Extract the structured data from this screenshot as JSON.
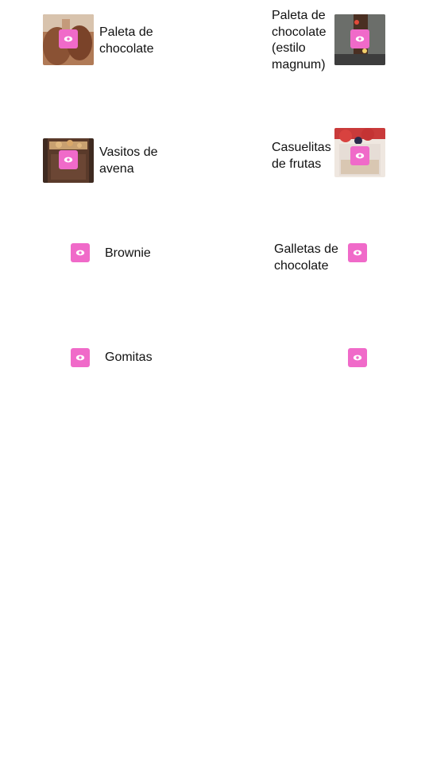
{
  "colors": {
    "accent": "#f06ac9",
    "text": "#111111",
    "background": "#ffffff"
  },
  "icons": {
    "view": "eye-icon"
  },
  "items": [
    {
      "line1": "Paleta de",
      "line2": "chocolate",
      "line3": "",
      "line4": ""
    },
    {
      "line1": "Paleta de",
      "line2": "chocolate",
      "line3": "(estilo",
      "line4": "magnum)"
    },
    {
      "line1": "Vasitos de",
      "line2": "avena",
      "line3": "",
      "line4": ""
    },
    {
      "line1": "Casuelitas",
      "line2": "de frutas",
      "line3": "",
      "line4": ""
    },
    {
      "line1": "Brownie",
      "line2": "",
      "line3": "",
      "line4": ""
    },
    {
      "line1": "Galletas de",
      "line2": "chocolate",
      "line3": "",
      "line4": ""
    },
    {
      "line1": "Gomitas",
      "line2": "",
      "line3": "",
      "line4": ""
    },
    {
      "line1": "",
      "line2": "",
      "line3": "",
      "line4": ""
    }
  ]
}
